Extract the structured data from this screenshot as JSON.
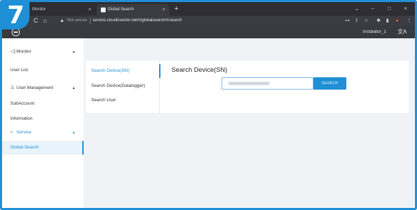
{
  "badge": {
    "step": "7"
  },
  "browser": {
    "tabs": [
      {
        "title": "Monitor",
        "close": "×"
      },
      {
        "title": "Global Search",
        "close": "×"
      }
    ],
    "new_tab": "+",
    "window_controls": {
      "chevron": "⌄",
      "minimize": "–",
      "maximize": "□",
      "close": "×"
    },
    "nav": {
      "back": "←",
      "forward": "→",
      "reload": "C",
      "home": "⌂"
    },
    "security": {
      "icon": "warning-triangle-icon",
      "glyph": "▲",
      "label": "Not secure"
    },
    "url": "service.cloudinverter.net/#/globalsearch/#/search",
    "toolbar_icons": [
      {
        "name": "key-icon",
        "glyph": "⊶"
      },
      {
        "name": "share-icon",
        "glyph": "⇪"
      },
      {
        "name": "star-icon",
        "glyph": "☆"
      },
      {
        "name": "extensions-icon",
        "glyph": "✱"
      },
      {
        "name": "sidepanel-icon",
        "glyph": "▮"
      },
      {
        "name": "profile-icon",
        "glyph": "●"
      },
      {
        "name": "menu-icon",
        "glyph": "⋮"
      }
    ]
  },
  "app": {
    "logo": "app-logo-icon",
    "user": "Instalator_1",
    "language_glyph": "文A"
  },
  "sidebar": {
    "items": [
      {
        "label": "Monitor",
        "icon": "◁)",
        "caret": "▲",
        "type": "group"
      },
      {
        "label": "User List",
        "type": "child"
      },
      {
        "label": "User Management",
        "icon": "♙",
        "caret": "▲",
        "type": "group"
      },
      {
        "label": "SubAccount",
        "type": "child"
      },
      {
        "label": "Information",
        "type": "child"
      },
      {
        "label": "Service",
        "icon": "⌕",
        "caret": "▲",
        "type": "group"
      },
      {
        "label": "Global Search",
        "type": "child"
      }
    ]
  },
  "search": {
    "tabs": [
      "Search Device(SN)",
      "Search Device(Datalogger)",
      "Search User"
    ],
    "title": "Search Device(SN)",
    "input_placeholder": "",
    "button_label": "SEARCH"
  },
  "colors": {
    "accent": "#1f8fd6",
    "header": "#373b40",
    "chrome": "#2d2d33"
  }
}
